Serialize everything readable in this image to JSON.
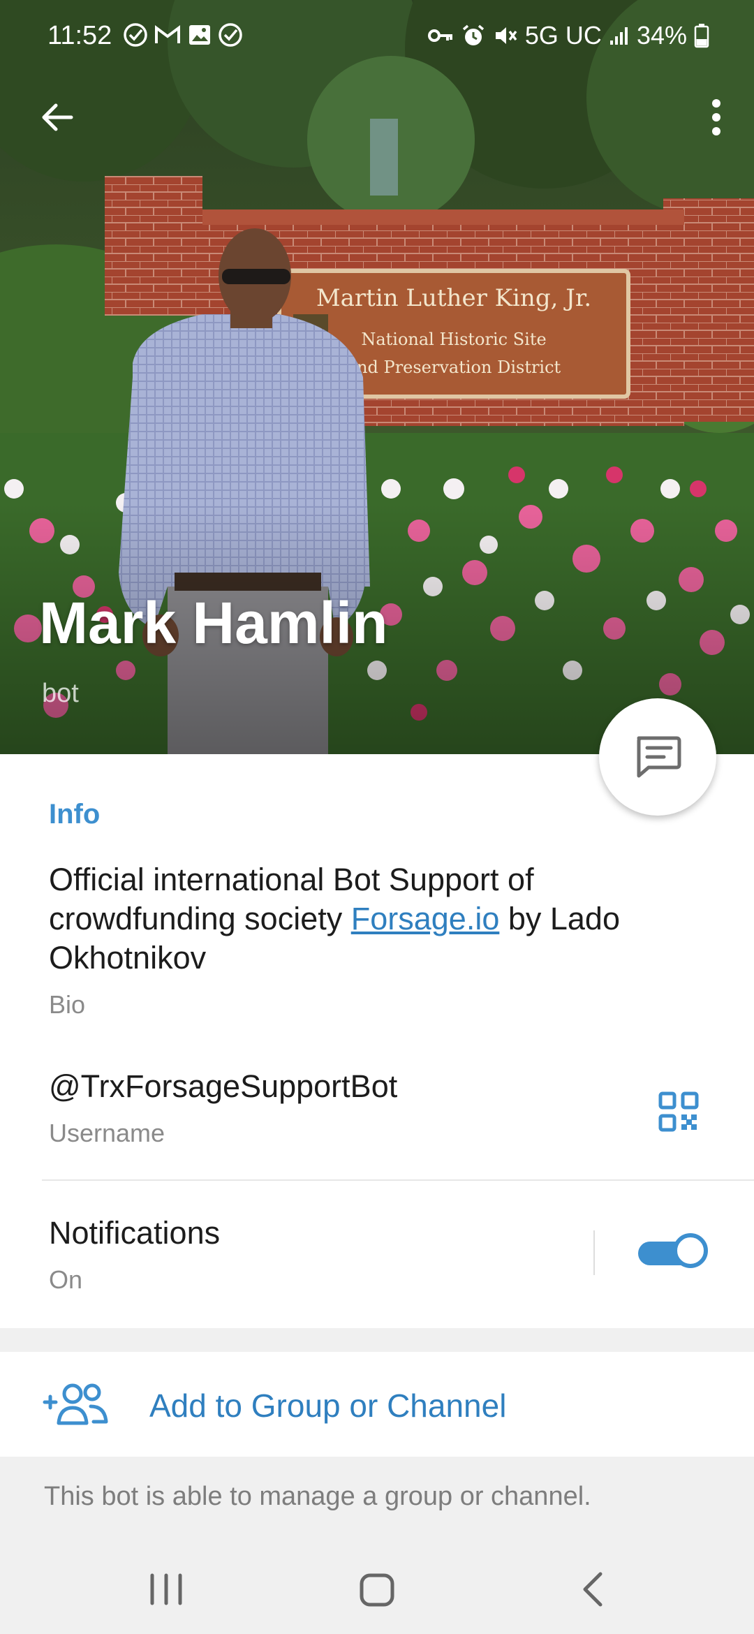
{
  "status_bar": {
    "time": "11:52",
    "network": "5G UC",
    "battery": "34%",
    "left_icons": [
      "check-circle-icon",
      "gmail-icon",
      "image-icon",
      "check-circle-icon"
    ],
    "right_icons": [
      "vpn-key-icon",
      "alarm-icon",
      "mute-icon",
      "signal-icon",
      "battery-icon"
    ]
  },
  "app_bar": {
    "back_icon": "arrow-back-icon",
    "menu_icon": "more-vert-icon"
  },
  "header": {
    "background": "profile-photo",
    "sign_line_1": "Martin Luther King, Jr.",
    "sign_line_2": "National Historic Site",
    "sign_line_3": "and Preservation District"
  },
  "profile": {
    "name": "Mark Hamlin",
    "subtitle": "bot"
  },
  "fab": {
    "icon": "message-icon"
  },
  "info": {
    "section_title": "Info",
    "bio_before_link": "Official international Bot Support of crowdfunding society ",
    "bio_link": "Forsage.io",
    "bio_after_link": " by Lado Okhotnikov",
    "bio_caption": "Bio",
    "username": "@TrxForsageSupportBot",
    "username_caption": "Username",
    "qr_icon": "qr-code-icon",
    "notifications_label": "Notifications",
    "notifications_value": "On",
    "notifications_enabled": true
  },
  "actions": {
    "add_group_label": "Add to Group or Channel",
    "add_group_icon": "add-users-icon"
  },
  "helper_text": "This bot is able to manage a group or channel.",
  "nav_bar": {
    "icons": [
      "recents-icon",
      "home-icon",
      "back-icon"
    ]
  },
  "colors": {
    "accent": "#3d8fcf",
    "link": "#2f7fbf",
    "background": "#f0f0f0",
    "card": "#ffffff"
  }
}
